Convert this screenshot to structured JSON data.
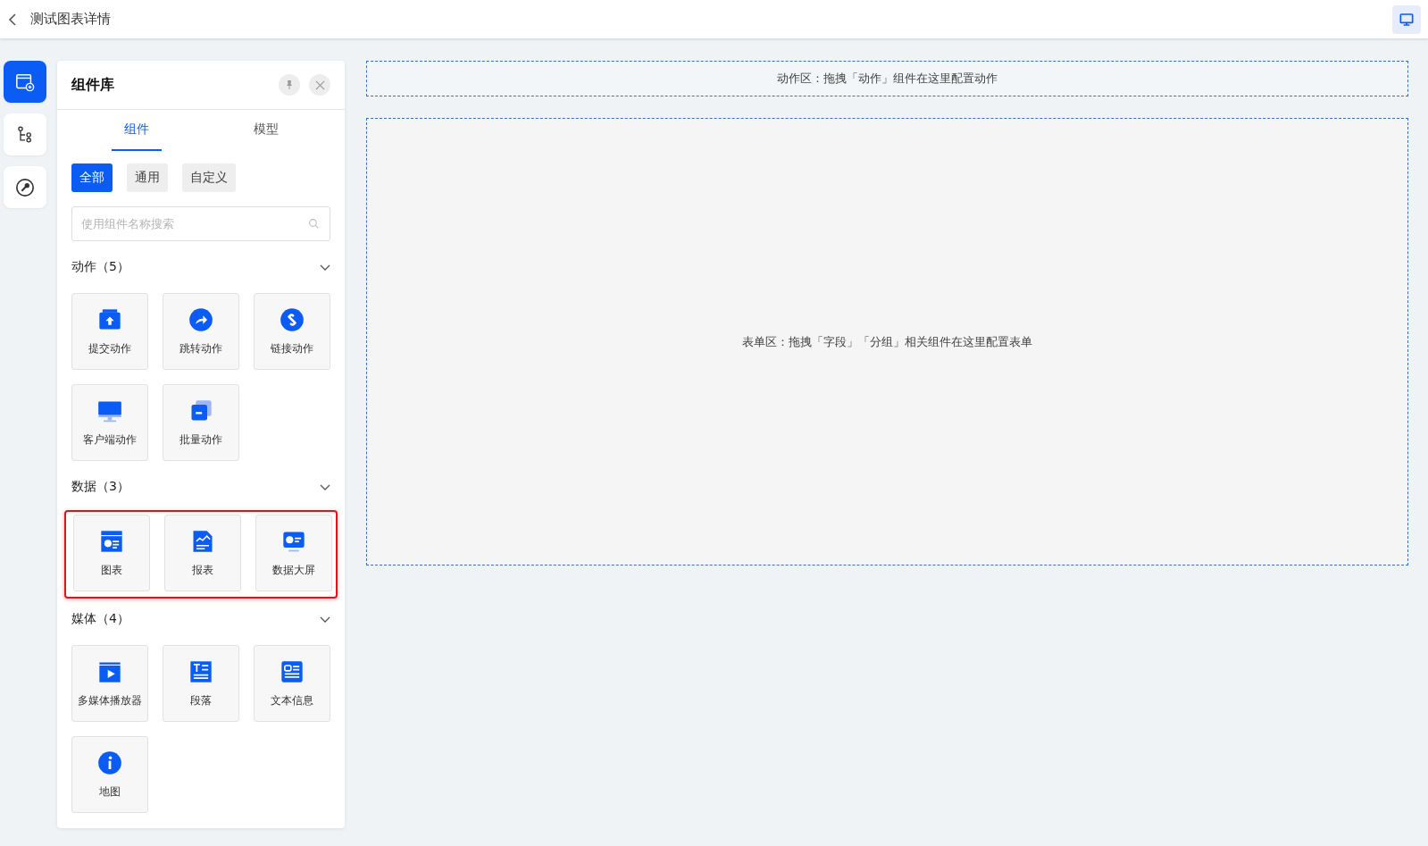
{
  "header": {
    "title": "测试图表详情"
  },
  "rail": [
    {
      "selected": true
    },
    {
      "selected": false
    },
    {
      "selected": false
    }
  ],
  "panel": {
    "title": "组件库",
    "tabs": [
      {
        "label": "组件",
        "selected": true
      },
      {
        "label": "模型",
        "selected": false
      }
    ],
    "filters": [
      {
        "label": "全部",
        "selected": true
      },
      {
        "label": "通用",
        "selected": false
      },
      {
        "label": "自定义",
        "selected": false
      }
    ],
    "search": {
      "placeholder": "使用组件名称搜索"
    },
    "sections": [
      {
        "title": "动作（5）",
        "expanded": true,
        "highlighted": false,
        "items": [
          "提交动作",
          "跳转动作",
          "链接动作",
          "客户端动作",
          "批量动作"
        ]
      },
      {
        "title": "数据（3）",
        "expanded": true,
        "highlighted": true,
        "items": [
          "图表",
          "报表",
          "数据大屏"
        ]
      },
      {
        "title": "媒体（4）",
        "expanded": true,
        "highlighted": false,
        "items": [
          "多媒体播放器",
          "段落",
          "文本信息",
          "地图"
        ]
      }
    ]
  },
  "canvas": {
    "action_zone": "动作区：拖拽「动作」组件在这里配置动作",
    "form_zone": "表单区：拖拽「字段」「分组」相关组件在这里配置表单"
  }
}
